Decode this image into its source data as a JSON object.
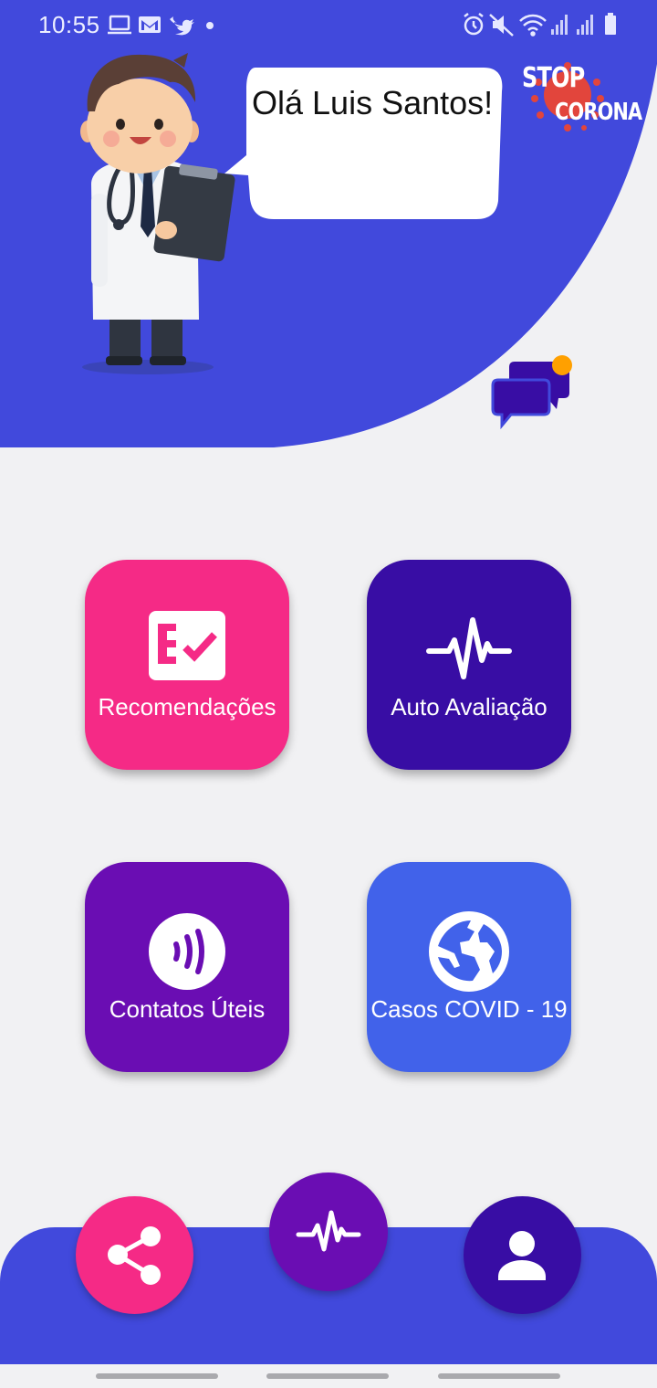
{
  "status_bar": {
    "time": "10:55",
    "left_icons": [
      "laptop-icon",
      "gmail-icon",
      "twitter-icon",
      "dot-icon"
    ],
    "right_icons": [
      "alarm-icon",
      "mute-icon",
      "wifi-icon",
      "signal-icon",
      "signal-icon",
      "battery-icon"
    ]
  },
  "header": {
    "greeting": "Olá Luis Santos!",
    "logo_line1": "STOP",
    "logo_line2": "CORONA",
    "chat_icon": "chat-bubbles-icon",
    "chat_has_notification": true
  },
  "tiles": [
    {
      "label": "Recomendações",
      "icon": "checklist-icon",
      "color": "#f52a86"
    },
    {
      "label": "Auto Avaliação",
      "icon": "heartbeat-icon",
      "color": "#380da4"
    },
    {
      "label": "Contatos Úteis",
      "icon": "contactless-icon",
      "color": "#6a0db3"
    },
    {
      "label": "Casos COVID - 19",
      "icon": "globe-icon",
      "color": "#4162ea"
    }
  ],
  "bottom_nav": {
    "share_icon": "share-icon",
    "center_icon": "heartbeat-icon",
    "profile_icon": "person-icon"
  },
  "colors": {
    "header_blue": "#4149dc",
    "pink": "#f52a86",
    "deep_purple": "#380da4",
    "purple": "#6a0db3",
    "blue": "#4162ea",
    "notification_dot": "#ffa000"
  }
}
